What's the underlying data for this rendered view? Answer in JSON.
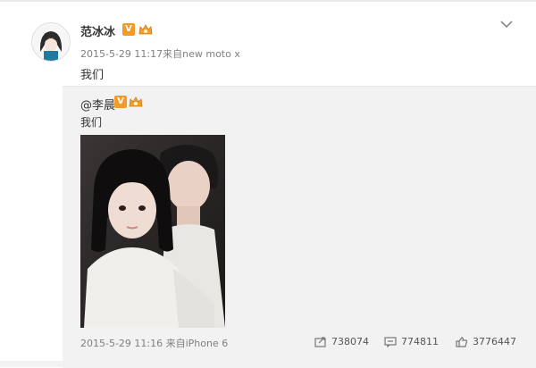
{
  "post": {
    "author": "范冰冰",
    "meta": "2015-5-29 11:17来自new moto x",
    "text": "我们"
  },
  "retweet": {
    "author": "@李晨",
    "text": "我们",
    "meta": "2015-5-29 11:16 来自iPhone 6",
    "actions": {
      "share_count": "738074",
      "comment_count": "774811",
      "like_count": "3776447"
    }
  },
  "icons": {
    "verified": "verified-badge-icon",
    "crown": "crown-badge-icon",
    "chevron": "chevron-down-icon",
    "share": "share-icon",
    "comment": "comment-icon",
    "like": "like-icon"
  },
  "colors": {
    "badge": "#f49a2a",
    "retweet_bg": "#f2f2f2",
    "meta_text": "#808080"
  }
}
